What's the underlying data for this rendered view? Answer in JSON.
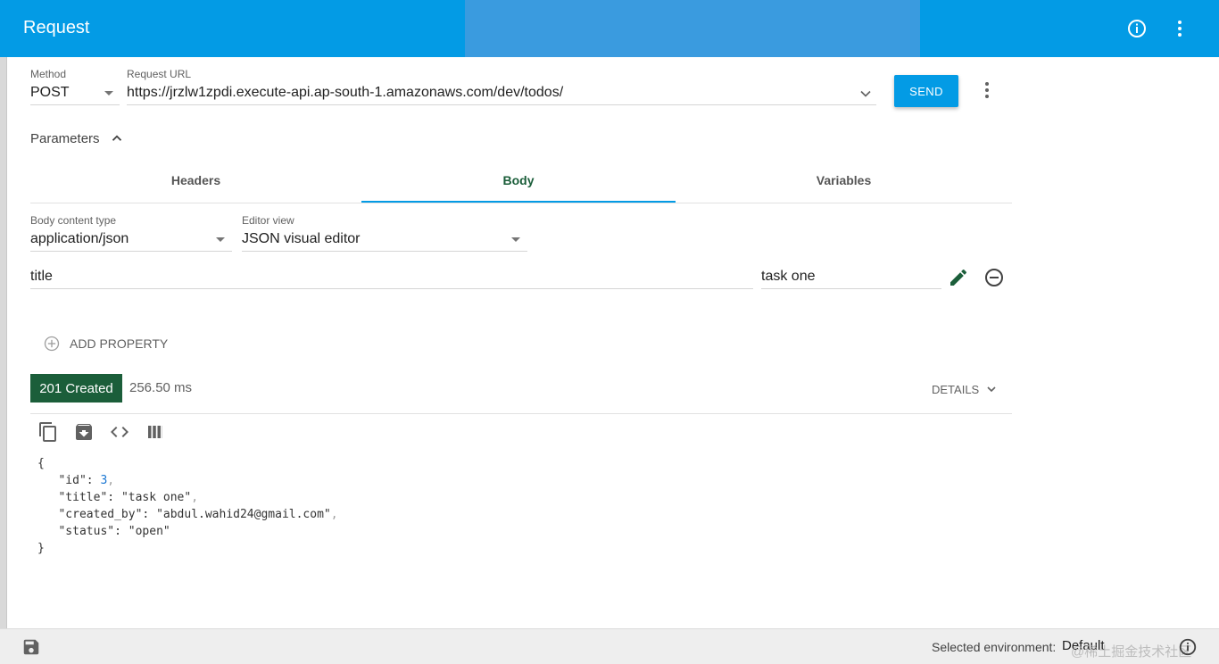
{
  "appbar": {
    "title": "Request",
    "info_icon": "info-icon",
    "menu_icon": "more-vert-icon"
  },
  "request": {
    "method_label": "Method",
    "method_value": "POST",
    "url_label": "Request URL",
    "url_value": "https://jrzlw1zpdi.execute-api.ap-south-1.amazonaws.com/dev/todos/",
    "send_label": "SEND"
  },
  "parameters": {
    "label": "Parameters"
  },
  "tabs": [
    {
      "label": "Headers",
      "active": false
    },
    {
      "label": "Body",
      "active": true
    },
    {
      "label": "Variables",
      "active": false
    }
  ],
  "body": {
    "content_type_label": "Body content type",
    "content_type_value": "application/json",
    "editor_view_label": "Editor view",
    "editor_view_value": "JSON visual editor",
    "property_name": "title",
    "property_value": "task one",
    "add_property_label": "ADD PROPERTY"
  },
  "response": {
    "status": "201 Created",
    "time": "256.50 ms",
    "details_label": "DETAILS",
    "json": {
      "open": "{",
      "close": "}",
      "id_key": "\"id\"",
      "id_value": "3",
      "title_key": "\"title\"",
      "title_value": "\"task one\"",
      "created_by_key": "\"created_by\"",
      "created_by_value": "\"abdul.wahid24@gmail.com\"",
      "status_key": "\"status\"",
      "status_value": "\"open\""
    }
  },
  "footer": {
    "env_label": "Selected environment:",
    "env_value": "Default",
    "watermark": "@稀土掘金技术社区"
  },
  "colors": {
    "primary": "#039be5",
    "success": "#1b5e3a",
    "accent_text": "#1b5e3a"
  }
}
